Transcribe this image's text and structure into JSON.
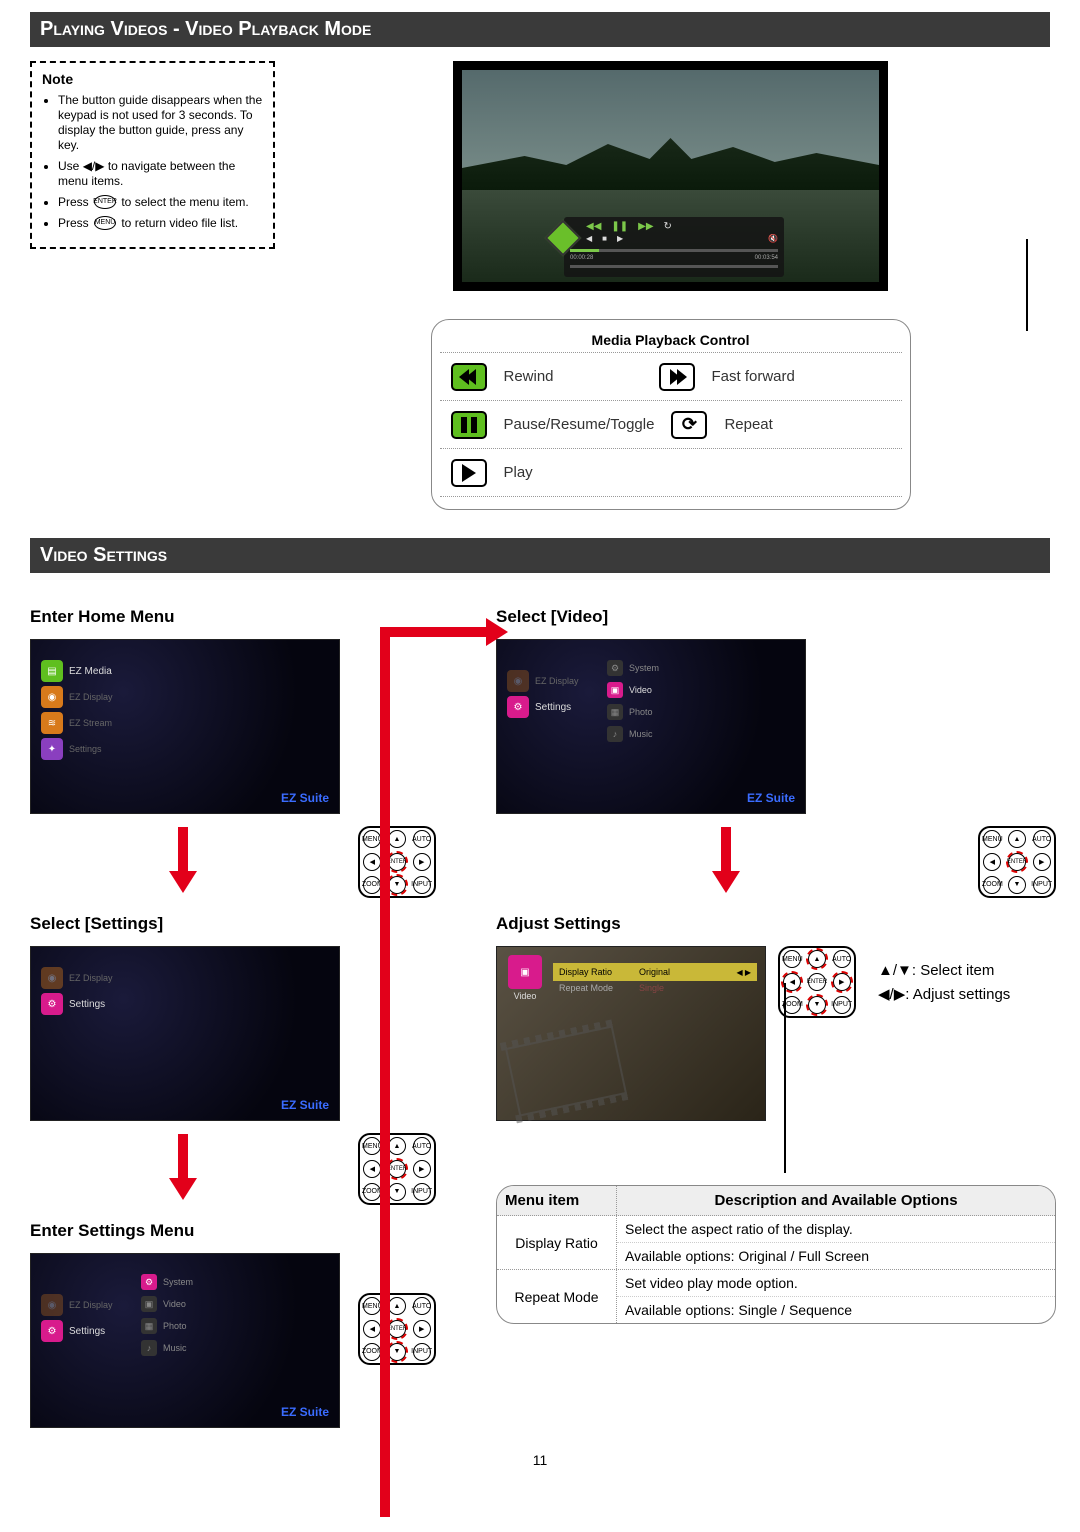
{
  "page_number": "11",
  "sections": {
    "playback_title": "Playing Videos - Video Playback Mode",
    "settings_title": "Video Settings"
  },
  "note": {
    "heading": "Note",
    "items": [
      "The button guide disappears when the keypad is not used for 3 seconds. To display the button guide, press any key.",
      "Use ◀/▶ to navigate between the menu items.",
      "Press ENTER to select the menu item.",
      "Press MENU to return video file list."
    ]
  },
  "playback_table": {
    "title": "Media Playback Control",
    "rewind": "Rewind",
    "fast_forward": "Fast forward",
    "pause": "Pause/Resume/Toggle",
    "repeat": "Repeat",
    "play": "Play"
  },
  "osd": {
    "time_start": "00:00:28",
    "time_end": "00:03:54"
  },
  "steps": {
    "enter_home": "Enter Home Menu",
    "select_video": "Select [Video]",
    "select_settings": "Select [Settings]",
    "adjust_settings": "Adjust Settings",
    "enter_settings_menu": "Enter Settings Menu"
  },
  "brand": "EZ Suite",
  "home_menu": {
    "item1": "EZ Media",
    "item2": "EZ Display",
    "item3": "EZ Stream",
    "item4": "Settings"
  },
  "settings_thumb": {
    "label": "Settings",
    "sub_system": "System",
    "sub_video": "Video",
    "sub_photo": "Photo",
    "sub_music": "Music"
  },
  "select_video_thumb": {
    "sub_system": "System",
    "sub_video": "Video",
    "sub_photo": "Photo",
    "sub_music": "Music"
  },
  "adjust_view": {
    "side": "Video",
    "row1_key": "Display Ratio",
    "row1_val": "Original",
    "row2_key": "Repeat Mode",
    "row2_val": "Single"
  },
  "legend": {
    "select": "▲/▼: Select item",
    "adjust": "◀/▶: Adjust settings"
  },
  "keypad": {
    "menu": "MENU",
    "auto": "AUTO",
    "enter": "ENTER",
    "zoom": "ZOOM",
    "input": "INPUT"
  },
  "options_table": {
    "h1": "Menu item",
    "h2": "Description and Available Options",
    "r1_name": "Display Ratio",
    "r1_l1": "Select the aspect ratio of the display.",
    "r1_l2": "Available options: Original / Full Screen",
    "r2_name": "Repeat Mode",
    "r2_l1": "Set video play mode option.",
    "r2_l2": "Available options: Single / Sequence"
  }
}
